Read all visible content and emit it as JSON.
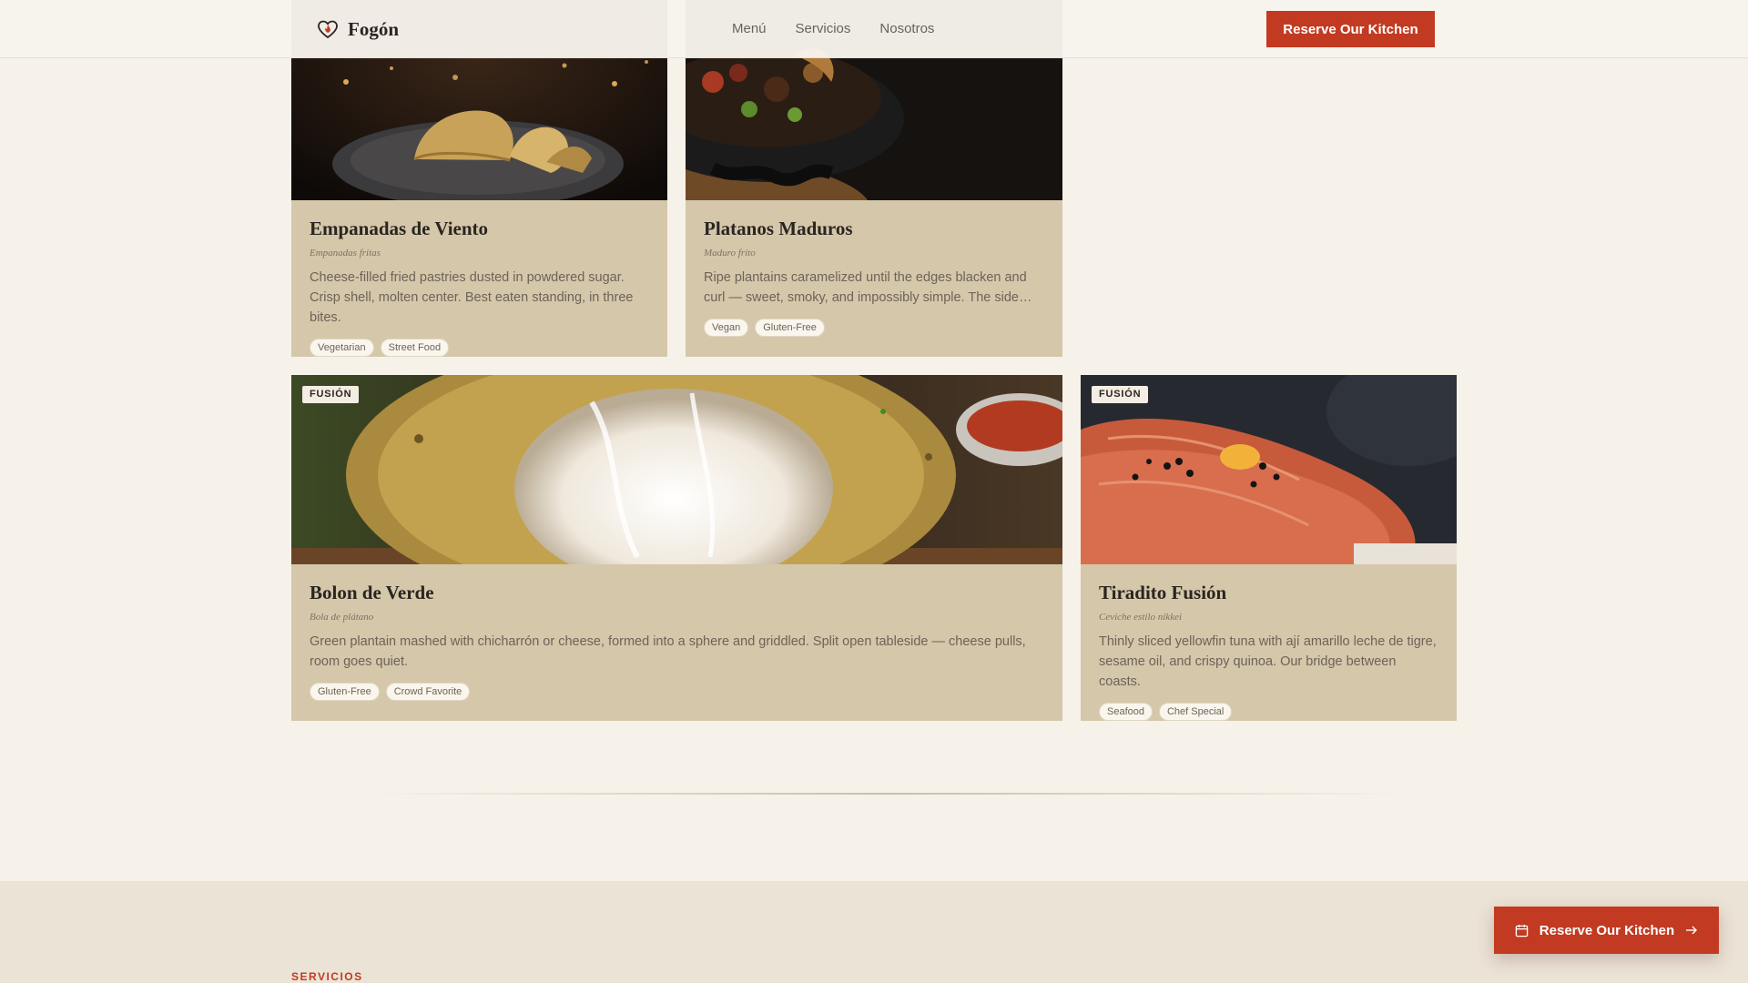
{
  "brand": {
    "name": "Fogón"
  },
  "nav": {
    "items": [
      "Menú",
      "Servicios",
      "Nosotros"
    ]
  },
  "header": {
    "cta_label": "Reserve Our Kitchen"
  },
  "cards": [
    {
      "title": "Empanadas de Viento",
      "subtitle": "Empanadas fritas",
      "description": "Cheese-filled fried pastries dusted in powdered sugar. Crisp shell, molten center. Best eaten standing, in three bites.",
      "tags": [
        "Vegetarian",
        "Street Food"
      ]
    },
    {
      "title": "Platanos Maduros",
      "subtitle": "Maduro frito",
      "description": "Ripe plantains caramelized until the edges blacken and curl — sweet, smoky, and impossibly simple. The side dish that steals the show.",
      "tags": [
        "Vegan",
        "Gluten-Free"
      ]
    },
    {
      "badge": "FUSIÓN",
      "title": "Bolon de Verde",
      "subtitle": "Bola de plátano",
      "description": "Green plantain mashed with chicharrón or cheese, formed into a sphere and griddled. Split open tableside — cheese pulls, room goes quiet.",
      "tags": [
        "Gluten-Free",
        "Crowd Favorite"
      ]
    },
    {
      "badge": "FUSIÓN",
      "title": "Tiradito Fusión",
      "subtitle": "Ceviche estilo nikkei",
      "description": "Thinly sliced yellowfin tuna with ají amarillo leche de tigre, sesame oil, and crispy quinoa. Our bridge between coasts.",
      "tags": [
        "Seafood",
        "Chef Special"
      ]
    }
  ],
  "section": {
    "label": "SERVICIOS"
  },
  "floating_cta": {
    "label": "Reserve Our Kitchen"
  },
  "icons": {
    "logo": "heart-flame-icon",
    "calendar": "calendar-icon",
    "arrow": "arrow-right-icon"
  },
  "colors": {
    "accent": "#c23a21",
    "card": "#d5c7aa",
    "background": "#f6f2ea"
  }
}
